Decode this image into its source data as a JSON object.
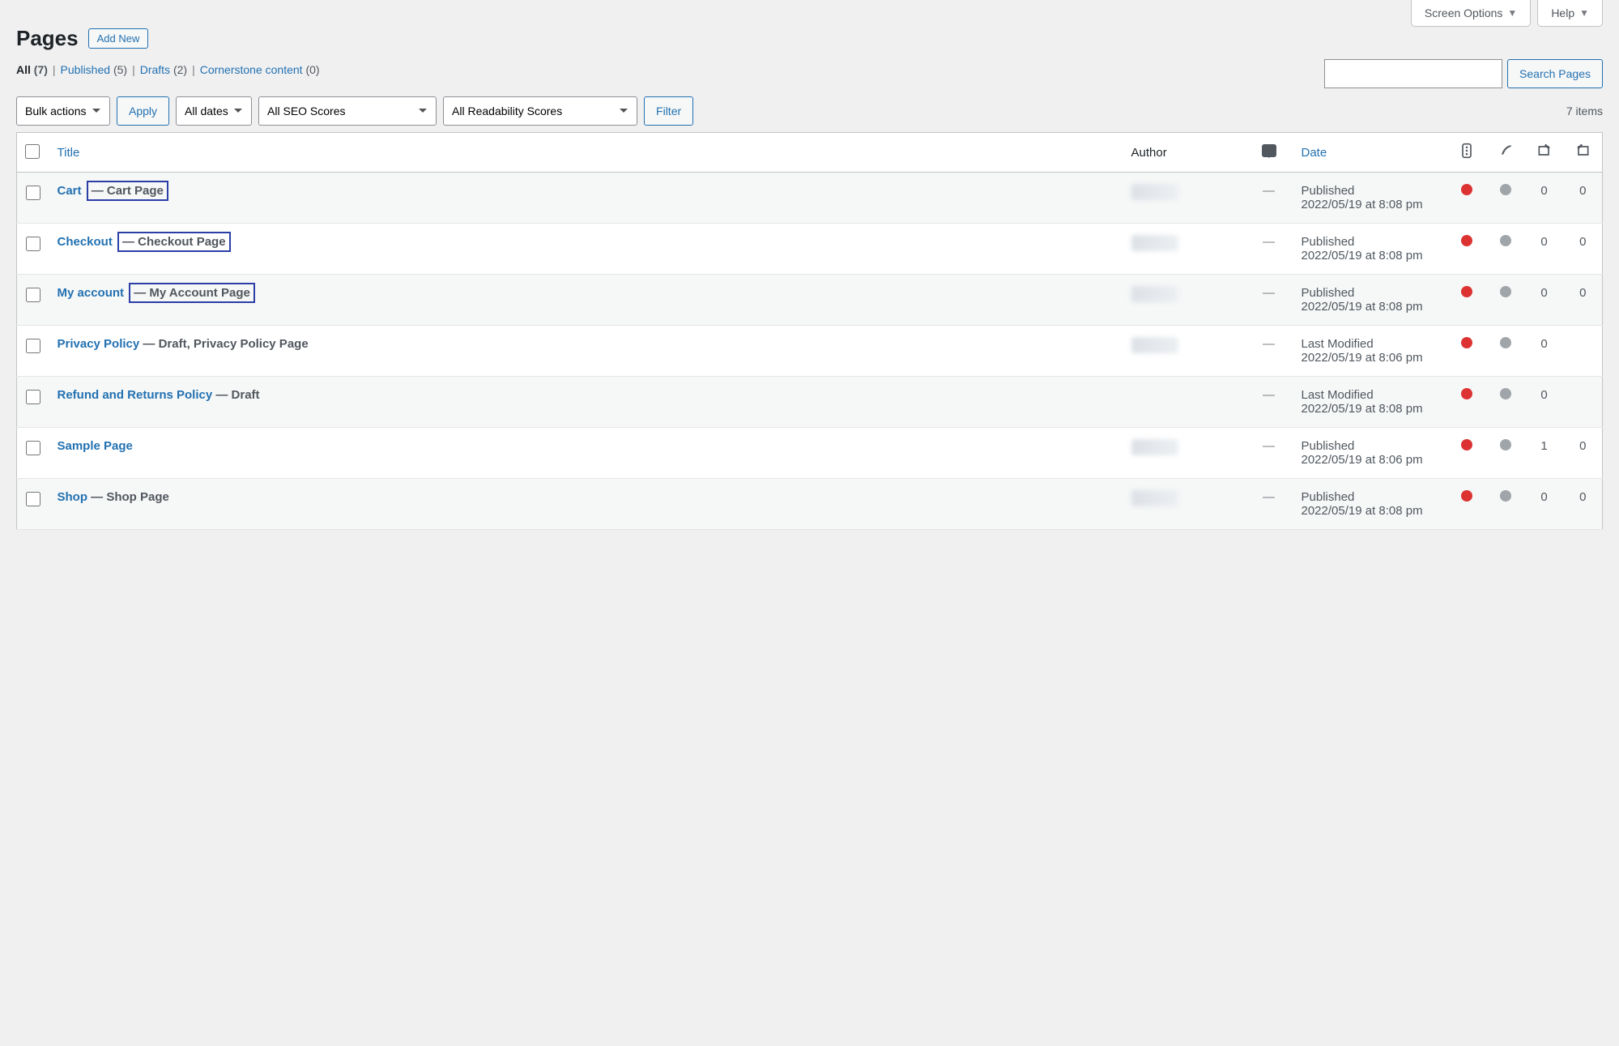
{
  "topTabs": {
    "screenOptions": "Screen Options",
    "help": "Help"
  },
  "header": {
    "title": "Pages",
    "addNew": "Add New"
  },
  "subsubsub": {
    "all": {
      "label": "All",
      "count": "(7)"
    },
    "published": {
      "label": "Published",
      "count": "(5)"
    },
    "drafts": {
      "label": "Drafts",
      "count": "(2)"
    },
    "cornerstone": {
      "label": "Cornerstone content",
      "count": "(0)"
    }
  },
  "search": {
    "button": "Search Pages"
  },
  "filters": {
    "bulkActions": "Bulk actions",
    "apply": "Apply",
    "allDates": "All dates",
    "seoScores": "All SEO Scores",
    "readability": "All Readability Scores",
    "filter": "Filter"
  },
  "itemCount": "7 items",
  "columns": {
    "title": "Title",
    "author": "Author",
    "date": "Date"
  },
  "rows": [
    {
      "title": "Cart",
      "suffix": "— Cart Page",
      "highlighted": true,
      "hasAuthor": true,
      "comments": "—",
      "statusLabel": "Published",
      "dateStr": "2022/05/19 at 8:08 pm",
      "seo": "red",
      "read": "grey",
      "links": "0",
      "linked": "0"
    },
    {
      "title": "Checkout",
      "suffix": "— Checkout Page",
      "highlighted": true,
      "hasAuthor": true,
      "comments": "—",
      "statusLabel": "Published",
      "dateStr": "2022/05/19 at 8:08 pm",
      "seo": "red",
      "read": "grey",
      "links": "0",
      "linked": "0"
    },
    {
      "title": "My account",
      "suffix": "— My Account Page",
      "highlighted": true,
      "hasAuthor": true,
      "comments": "—",
      "statusLabel": "Published",
      "dateStr": "2022/05/19 at 8:08 pm",
      "seo": "red",
      "read": "grey",
      "links": "0",
      "linked": "0"
    },
    {
      "title": "Privacy Policy",
      "suffix": "— Draft, Privacy Policy Page",
      "highlighted": false,
      "hasAuthor": true,
      "comments": "—",
      "statusLabel": "Last Modified",
      "dateStr": "2022/05/19 at 8:06 pm",
      "seo": "red",
      "read": "grey",
      "links": "0",
      "linked": ""
    },
    {
      "title": "Refund and Returns Policy",
      "suffix": "— Draft",
      "highlighted": false,
      "hasAuthor": false,
      "comments": "—",
      "statusLabel": "Last Modified",
      "dateStr": "2022/05/19 at 8:08 pm",
      "seo": "red",
      "read": "grey",
      "links": "0",
      "linked": ""
    },
    {
      "title": "Sample Page",
      "suffix": "",
      "highlighted": false,
      "hasAuthor": true,
      "comments": "—",
      "statusLabel": "Published",
      "dateStr": "2022/05/19 at 8:06 pm",
      "seo": "red",
      "read": "grey",
      "links": "1",
      "linked": "0"
    },
    {
      "title": "Shop",
      "suffix": "— Shop Page",
      "highlighted": false,
      "hasAuthor": true,
      "comments": "—",
      "statusLabel": "Published",
      "dateStr": "2022/05/19 at 8:08 pm",
      "seo": "red",
      "read": "grey",
      "links": "0",
      "linked": "0"
    }
  ]
}
